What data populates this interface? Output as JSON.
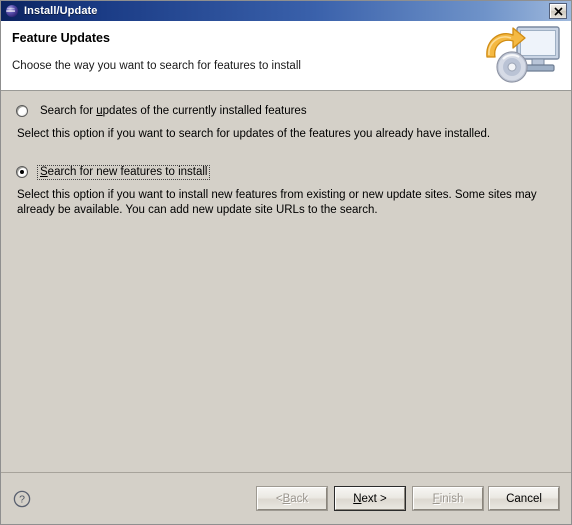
{
  "window": {
    "title": "Install/Update",
    "icon": "eclipse-globe-icon",
    "close_label": "×"
  },
  "header": {
    "title": "Feature Updates",
    "subtitle": "Choose the way you want to search for features to install",
    "graphic": "monitor-cd-update-icon"
  },
  "options": [
    {
      "id": "search-updates",
      "label_before": "Search for ",
      "mnemonic": "u",
      "label_after": "pdates of the currently installed features",
      "selected": false,
      "focused": false,
      "description": "Select this option if you want to search for updates of the features you already have installed."
    },
    {
      "id": "search-new-features",
      "label_before": "",
      "mnemonic": "S",
      "label_after": "earch for new features to install",
      "selected": true,
      "focused": true,
      "description": "Select this option if you want to install new features from existing or new update sites. Some sites may already be available. You can add new update site URLs to the search."
    }
  ],
  "footer": {
    "help_icon": "help-question-icon",
    "buttons": [
      {
        "id": "back",
        "before": "< ",
        "mnemonic": "B",
        "after": "ack",
        "disabled": true,
        "default": false
      },
      {
        "id": "next",
        "before": "",
        "mnemonic": "N",
        "after": "ext >",
        "disabled": false,
        "default": true
      },
      {
        "id": "finish",
        "before": "",
        "mnemonic": "F",
        "after": "inish",
        "disabled": true,
        "default": false
      },
      {
        "id": "cancel",
        "before": "Cancel",
        "mnemonic": "",
        "after": "",
        "disabled": false,
        "default": false
      }
    ]
  },
  "colors": {
    "dialog_background": "#d4d0c8",
    "titlebar_start": "#0b2360",
    "titlebar_end": "#9fb9dd",
    "header_background": "#ffffff",
    "text": "#000000",
    "disabled_text": "#9a958d"
  }
}
